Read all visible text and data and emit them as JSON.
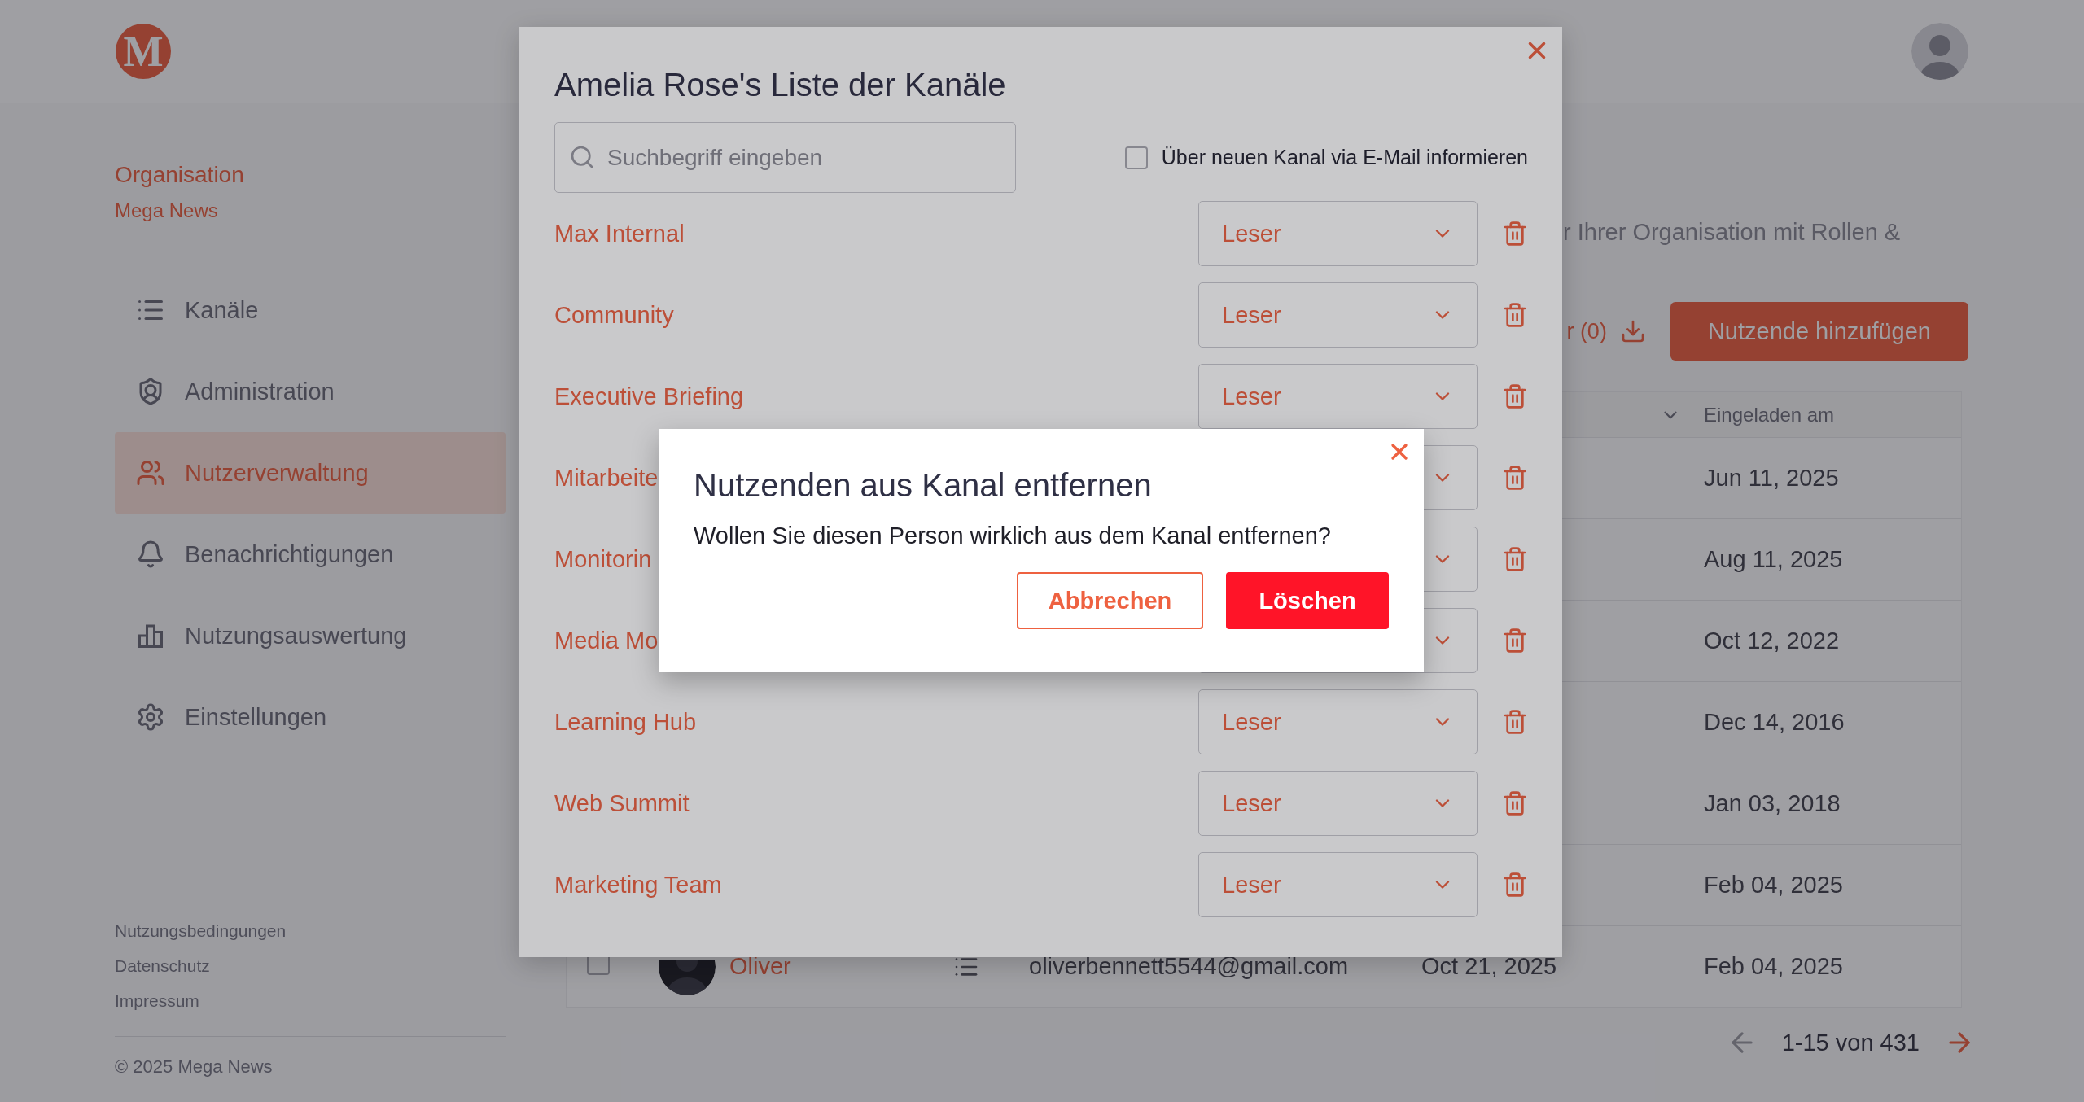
{
  "header": {
    "logo": "M"
  },
  "sidebar": {
    "org_label": "Organisation",
    "org_name": "Mega News",
    "items": [
      {
        "label": "Kanäle",
        "selected": false
      },
      {
        "label": "Administration",
        "selected": false
      },
      {
        "label": "Nutzerverwaltung",
        "selected": true
      },
      {
        "label": "Benachrichtigungen",
        "selected": false
      },
      {
        "label": "Nutzungsauswertung",
        "selected": false
      },
      {
        "label": "Einstellungen",
        "selected": false
      }
    ],
    "footer_links": [
      "Nutzungsbedingungen",
      "Datenschutz",
      "Impressum"
    ],
    "copyright": "© 2025 Mega News"
  },
  "main": {
    "description": "r Ihrer Organisation mit Rollen &",
    "toolbar": {
      "filter": "r (0)",
      "add_button": "Nutzende hinzufügen"
    },
    "table": {
      "columns": [
        {
          "label": "Eingeladen am"
        }
      ],
      "rows": [
        {
          "invited": "Jun 11, 2025"
        },
        {
          "invited": "Aug 11, 2025"
        },
        {
          "invited": "Oct 12, 2022"
        },
        {
          "invited": "Dec 14, 2016"
        },
        {
          "invited": "Jan 03, 2018"
        },
        {
          "invited": "Feb 04, 2025"
        },
        {
          "checked": false,
          "name": "Oliver",
          "email": "oliverbennett5544@gmail.com",
          "column_6": "Oct 21, 2025",
          "invited": "Feb 04, 2025"
        }
      ]
    },
    "pagination": {
      "range": "1-15 von 431",
      "previous": {
        "disabled": true
      },
      "next": {
        "disabled": false
      }
    }
  },
  "channel_dialog": {
    "title": "Amelia Rose's Liste der Kanäle",
    "search": {
      "placeholder": "Suchbegriff eingeben"
    },
    "notify": {
      "label": "Über neuen Kanal via E-Mail informieren",
      "checked": false
    },
    "channels": [
      {
        "name": "Max Internal",
        "role": "Leser"
      },
      {
        "name": "Community",
        "role": "Leser"
      },
      {
        "name": "Executive Briefing",
        "role": "Leser"
      },
      {
        "name": "Mitarbeite"
      },
      {
        "name": "Monitorin"
      },
      {
        "name": "Media Mo"
      },
      {
        "name": "Learning Hub",
        "role": "Leser"
      },
      {
        "name": "Web Summit",
        "role": "Leser"
      },
      {
        "name": "Marketing Team",
        "role": "Leser"
      }
    ]
  },
  "confirm_dialog": {
    "title": "Nutzenden aus Kanal entfernen",
    "message": "Wollen Sie diesen Person wirklich aus dem Kanal entfernen?",
    "cancel": "Abbrechen",
    "confirm": "Löschen"
  }
}
